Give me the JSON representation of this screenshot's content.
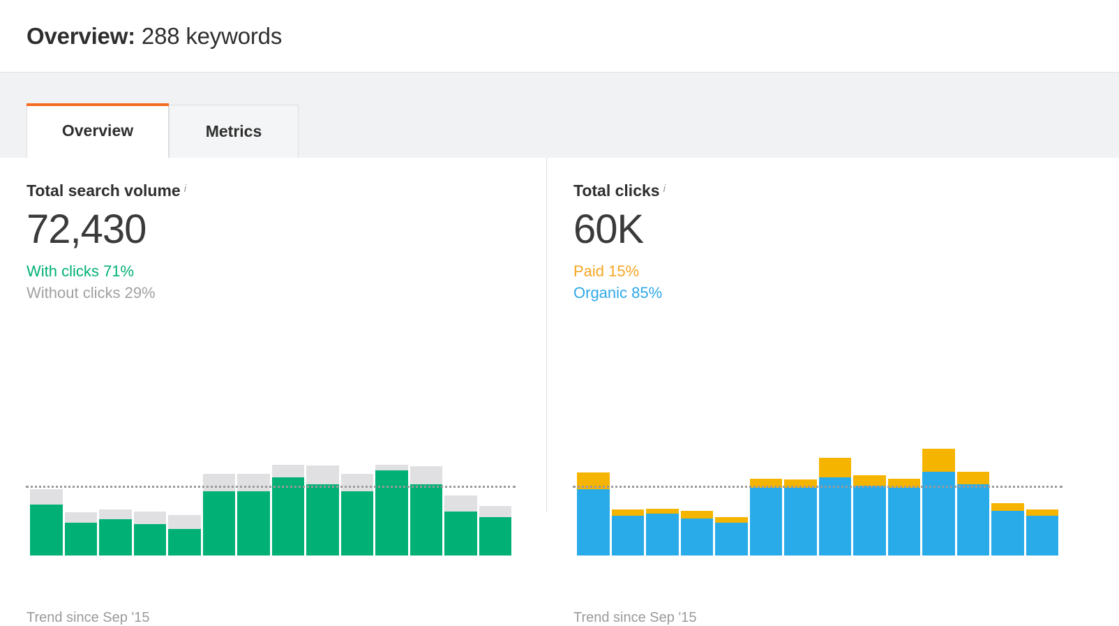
{
  "header": {
    "title_strong": "Overview:",
    "title_light": " 288 keywords"
  },
  "tabs": [
    {
      "label": "Overview",
      "active": true
    },
    {
      "label": "Metrics",
      "active": false
    }
  ],
  "colors": {
    "tab_accent": "#f26c21",
    "green": "#00b074",
    "gray": "#e0e0e2",
    "blue": "#29abe9",
    "orange": "#f5b400",
    "muted_text": "#9a9a9a"
  },
  "panels": [
    {
      "id": "total-search-volume",
      "label": "Total search volume",
      "info_icon": "info-icon",
      "value": "72,430",
      "legend": [
        {
          "text": "With clicks 71%",
          "color_key": "green"
        },
        {
          "text": "Without clicks 29%",
          "color_key": "gray"
        }
      ],
      "caption": "Trend since Sep '15"
    },
    {
      "id": "total-clicks",
      "label": "Total clicks",
      "info_icon": "info-icon",
      "value": "60K",
      "legend": [
        {
          "text": "Paid 15%",
          "color_key": "orange"
        },
        {
          "text": "Organic 85%",
          "color_key": "blue"
        }
      ],
      "caption": "Trend since Sep '15"
    }
  ],
  "chart_data": [
    {
      "type": "bar",
      "id": "total-search-volume-trend",
      "title": "Total search volume",
      "subtitle": "Trend since Sep '15",
      "stacked": true,
      "grid": false,
      "legend_position": "above-chart",
      "xlabel": "",
      "ylabel": "",
      "ylim": [
        0,
        165
      ],
      "average_line": 97,
      "categories": [
        "1",
        "2",
        "3",
        "4",
        "5",
        "6",
        "7",
        "8",
        "9",
        "10",
        "11",
        "12",
        "13",
        "14"
      ],
      "series": [
        {
          "name": "With clicks",
          "color": "#00b074",
          "values": [
            73,
            47,
            52,
            45,
            38,
            92,
            92,
            112,
            102,
            92,
            122,
            102,
            63,
            55
          ]
        },
        {
          "name": "Without clicks",
          "color": "#e0e0e2",
          "values": [
            22,
            15,
            14,
            18,
            20,
            25,
            25,
            18,
            27,
            25,
            8,
            26,
            23,
            16
          ]
        }
      ]
    },
    {
      "type": "bar",
      "id": "total-clicks-trend",
      "title": "Total clicks",
      "subtitle": "Trend since Sep '15",
      "stacked": true,
      "grid": false,
      "legend_position": "above-chart",
      "xlabel": "",
      "ylabel": "",
      "ylim": [
        0,
        165
      ],
      "average_line": 97,
      "categories": [
        "1",
        "2",
        "3",
        "4",
        "5",
        "6",
        "7",
        "8",
        "9",
        "10",
        "11",
        "12",
        "13",
        "14"
      ],
      "series": [
        {
          "name": "Organic",
          "color": "#29abe9",
          "values": [
            95,
            57,
            60,
            53,
            47,
            97,
            97,
            112,
            100,
            97,
            120,
            102,
            64,
            57
          ]
        },
        {
          "name": "Paid",
          "color": "#f5b400",
          "values": [
            24,
            9,
            7,
            11,
            8,
            13,
            12,
            28,
            15,
            13,
            33,
            18,
            11,
            9
          ]
        }
      ]
    }
  ]
}
